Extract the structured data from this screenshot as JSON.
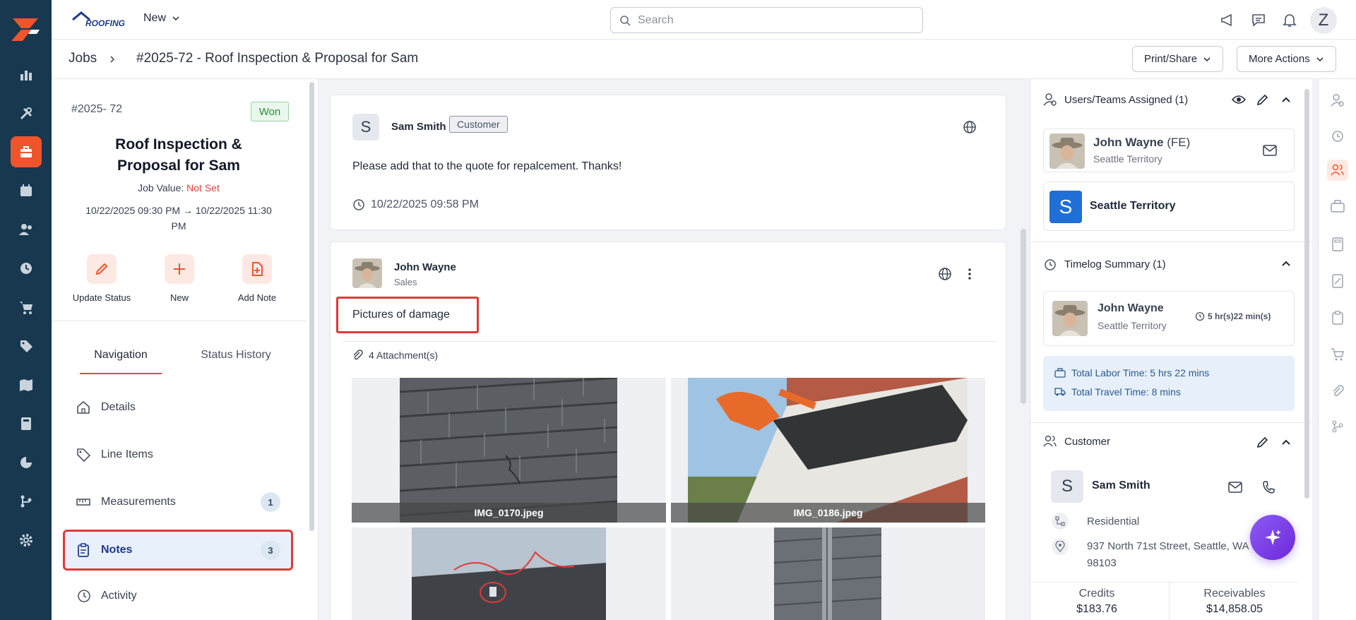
{
  "topbar": {
    "brand": "ROOFING",
    "new_label": "New",
    "search_placeholder": "Search",
    "user_initial": "Z"
  },
  "breadcrumb": {
    "root": "Jobs",
    "current": "#2025-72 - Roof Inspection & Proposal for Sam"
  },
  "actions": {
    "print_share": "Print/Share",
    "more_actions": "More Actions"
  },
  "job": {
    "id": "#2025- 72",
    "status": "Won",
    "title_line1": "Roof Inspection &",
    "title_line2": "Proposal for Sam",
    "value_label": "Job Value:",
    "value": "Not Set",
    "dates_line1": "10/22/2025 09:30 PM → 10/22/2025 11:30",
    "dates_line2": "PM"
  },
  "quick_actions": {
    "update_status": "Update Status",
    "new": "New",
    "add_note": "Add Note"
  },
  "tabs": {
    "navigation": "Navigation",
    "status_history": "Status History"
  },
  "nav": {
    "details": "Details",
    "line_items": "Line Items",
    "measurements": "Measurements",
    "measurements_count": "1",
    "notes": "Notes",
    "notes_count": "3",
    "activity": "Activity"
  },
  "note1": {
    "initial": "S",
    "author": "Sam Smith",
    "tag": "Customer",
    "body": "Please add that to the quote for repalcement. Thanks!",
    "timestamp": "10/22/2025 09:58 PM"
  },
  "note2": {
    "author": "John Wayne",
    "role": "Sales",
    "body": "Pictures of damage",
    "attachments": "4 Attachment(s)",
    "photos": [
      "IMG_0170.jpeg",
      "IMG_0186.jpeg"
    ]
  },
  "assigned": {
    "title": "Users/Teams Assigned (1)",
    "user_name": "John Wayne",
    "user_suffix": "(FE)",
    "user_territory": "Seattle Territory",
    "team_initial": "S",
    "team_name": "Seattle Territory"
  },
  "timelog": {
    "title": "Timelog Summary (1)",
    "user_name": "John Wayne",
    "user_territory": "Seattle Territory",
    "duration": "5 hr(s)22 min(s)",
    "total_labor": "Total Labor Time: 5 hrs 22 mins",
    "total_travel": "Total Travel Time: 8 mins"
  },
  "customer": {
    "title": "Customer",
    "initial": "S",
    "name": "Sam Smith",
    "type": "Residential",
    "address_line1": "937 North 71st Street, Seattle, WA",
    "address_line2": "98103",
    "credits_label": "Credits",
    "credits_value": "$183.76",
    "receivables_label": "Receivables",
    "receivables_value": "$14,858.05"
  },
  "colors": {
    "rail_bg": "#17384f",
    "accent": "#f0542c",
    "highlight_red": "#e0393a",
    "fab_purple": "#7c3aed"
  }
}
